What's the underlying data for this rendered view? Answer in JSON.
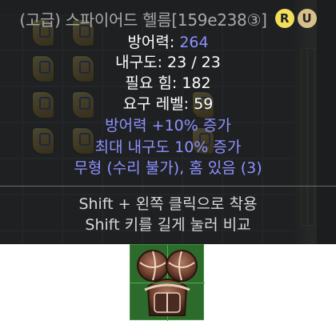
{
  "tooltip": {
    "title": "(고급) 스파이어드 헬름[159e238③]",
    "badges": [
      "R",
      "U"
    ],
    "defense_label": "방어력: ",
    "defense_value": "264",
    "durability": "내구도: 23 / 23",
    "required_strength": "필요 힘: 182",
    "required_level": "요구 레벨: 59",
    "magic_props": [
      "방어력 +10% 증가",
      "최대 내구도 10% 증가",
      "무형 (수리 불가), 홈 있음 (3)"
    ],
    "hints": [
      "Shift + 왼쪽 클릭으로 착용",
      "Shift 키를 길게 눌러 비교"
    ]
  },
  "colors": {
    "title": "#a9a9a9",
    "magic": "#8f91ff",
    "normal": "#ffffff",
    "hint": "#d7d7d7",
    "badge_r": "#f2df5c",
    "badge_u": "#d8c08a"
  },
  "icons": {
    "item": "spired-helm-icon",
    "rune": "rune-icon"
  }
}
